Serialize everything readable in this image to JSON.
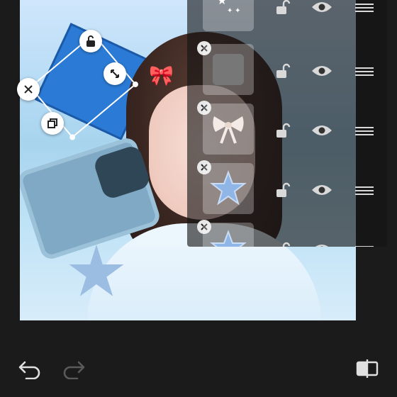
{
  "canvas": {
    "layer_thumbs": [
      "stars-sticker",
      "blank-square-sticker",
      "bow-sticker",
      "star-sticker",
      "star-sticker"
    ]
  },
  "selection": {
    "controls": [
      "close-icon",
      "unlock-icon",
      "resize-icon",
      "duplicate-icon"
    ]
  },
  "layers_panel": {
    "rows": [
      {
        "thumb": "stars-icon",
        "lock": "unlock-icon",
        "visible": "eye-icon",
        "drag": "drag-handle-icon"
      },
      {
        "thumb": "blank-square-icon",
        "lock": "unlock-icon",
        "visible": "eye-icon",
        "drag": "drag-handle-icon"
      },
      {
        "thumb": "bow-icon",
        "lock": "unlock-icon",
        "visible": "eye-icon",
        "drag": "drag-handle-icon"
      },
      {
        "thumb": "star-icon",
        "lock": "unlock-icon",
        "visible": "eye-icon",
        "drag": "drag-handle-icon"
      },
      {
        "thumb": "star-icon",
        "lock": "unlock-icon",
        "visible": "eye-icon",
        "drag": "drag-handle-icon"
      }
    ]
  },
  "bottom_bar": {
    "undo": "undo-icon",
    "redo": "redo-icon",
    "compare": "compare-icon"
  },
  "colors": {
    "background": "#1b1b1b",
    "panel": "rgba(20,20,20,0.62)",
    "icon": "#d9d9d9"
  }
}
